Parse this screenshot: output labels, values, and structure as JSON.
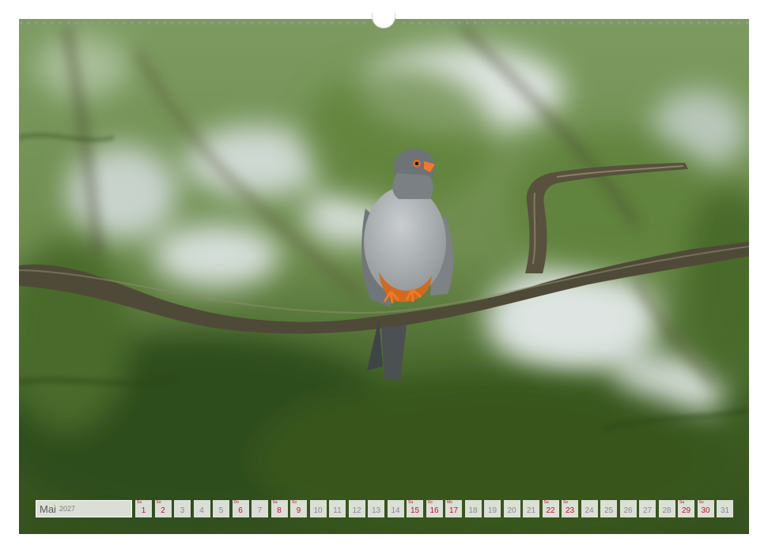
{
  "colors": {
    "foliage_dark": "#2e4a1c",
    "foliage_mid": "#5d7f3a",
    "sky_light": "#dfe6e3",
    "branch": "#4f4a37",
    "bird_grey": "#9a9fa2",
    "bird_orange": "#e07a22",
    "holiday_red": "#c8102e"
  },
  "icons": [
    "binder-hole-icon",
    "hanger-notch-icon"
  ],
  "calendar": {
    "month": "Mai",
    "year": "2027",
    "days": [
      {
        "num": "1",
        "wd": "Sa",
        "red": true
      },
      {
        "num": "2",
        "wd": "So",
        "red": true
      },
      {
        "num": "3",
        "wd": "",
        "red": false
      },
      {
        "num": "4",
        "wd": "",
        "red": false
      },
      {
        "num": "5",
        "wd": "",
        "red": false
      },
      {
        "num": "6",
        "wd": "Do",
        "red": true
      },
      {
        "num": "7",
        "wd": "",
        "red": false
      },
      {
        "num": "8",
        "wd": "Sa",
        "red": true
      },
      {
        "num": "9",
        "wd": "So",
        "red": true
      },
      {
        "num": "10",
        "wd": "",
        "red": false
      },
      {
        "num": "11",
        "wd": "",
        "red": false
      },
      {
        "num": "12",
        "wd": "",
        "red": false
      },
      {
        "num": "13",
        "wd": "",
        "red": false
      },
      {
        "num": "14",
        "wd": "",
        "red": false
      },
      {
        "num": "15",
        "wd": "Sa",
        "red": true
      },
      {
        "num": "16",
        "wd": "So",
        "red": true
      },
      {
        "num": "17",
        "wd": "Mo",
        "red": true
      },
      {
        "num": "18",
        "wd": "",
        "red": false
      },
      {
        "num": "19",
        "wd": "",
        "red": false
      },
      {
        "num": "20",
        "wd": "",
        "red": false
      },
      {
        "num": "21",
        "wd": "",
        "red": false
      },
      {
        "num": "22",
        "wd": "Sa",
        "red": true
      },
      {
        "num": "23",
        "wd": "So",
        "red": true
      },
      {
        "num": "24",
        "wd": "",
        "red": false
      },
      {
        "num": "25",
        "wd": "",
        "red": false
      },
      {
        "num": "26",
        "wd": "",
        "red": false
      },
      {
        "num": "27",
        "wd": "",
        "red": false
      },
      {
        "num": "28",
        "wd": "",
        "red": false
      },
      {
        "num": "29",
        "wd": "Sa",
        "red": true
      },
      {
        "num": "30",
        "wd": "So",
        "red": true
      },
      {
        "num": "31",
        "wd": "",
        "red": false
      }
    ]
  }
}
